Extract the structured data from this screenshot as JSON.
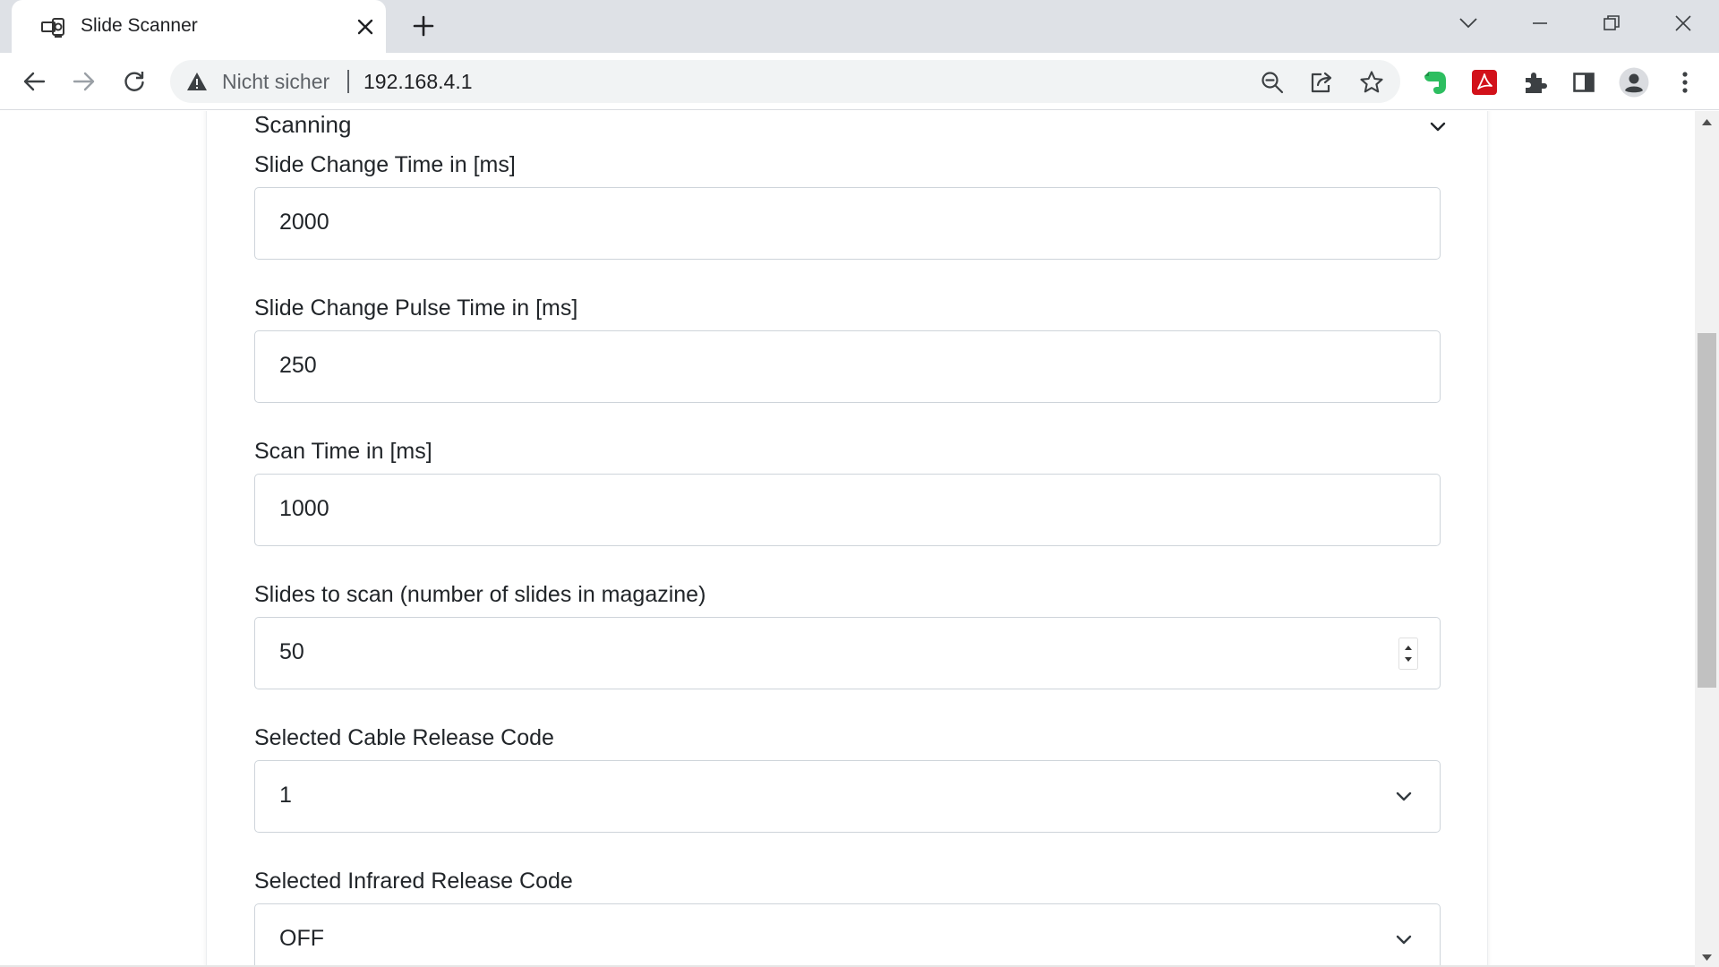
{
  "browser": {
    "tab": {
      "title": "Slide Scanner"
    },
    "address": {
      "security_label": "Nicht sicher",
      "url": "192.168.4.1"
    }
  },
  "colors": {
    "evernote": "#2dbe60",
    "acrobat": "#d2111a",
    "icon_gray": "#5f6368"
  },
  "section": {
    "title": "Scanning"
  },
  "fields": [
    {
      "label": "Slide Change Time in [ms]",
      "value": "2000",
      "kind": "text"
    },
    {
      "label": "Slide Change Pulse Time in [ms]",
      "value": "250",
      "kind": "text"
    },
    {
      "label": "Scan Time in [ms]",
      "value": "1000",
      "kind": "text"
    },
    {
      "label": "Slides to scan (number of slides in magazine)",
      "value": "50",
      "kind": "number"
    },
    {
      "label": "Selected Cable Release Code",
      "value": "1",
      "kind": "select"
    },
    {
      "label": "Selected Infrared Release Code",
      "value": "OFF",
      "kind": "select"
    }
  ]
}
